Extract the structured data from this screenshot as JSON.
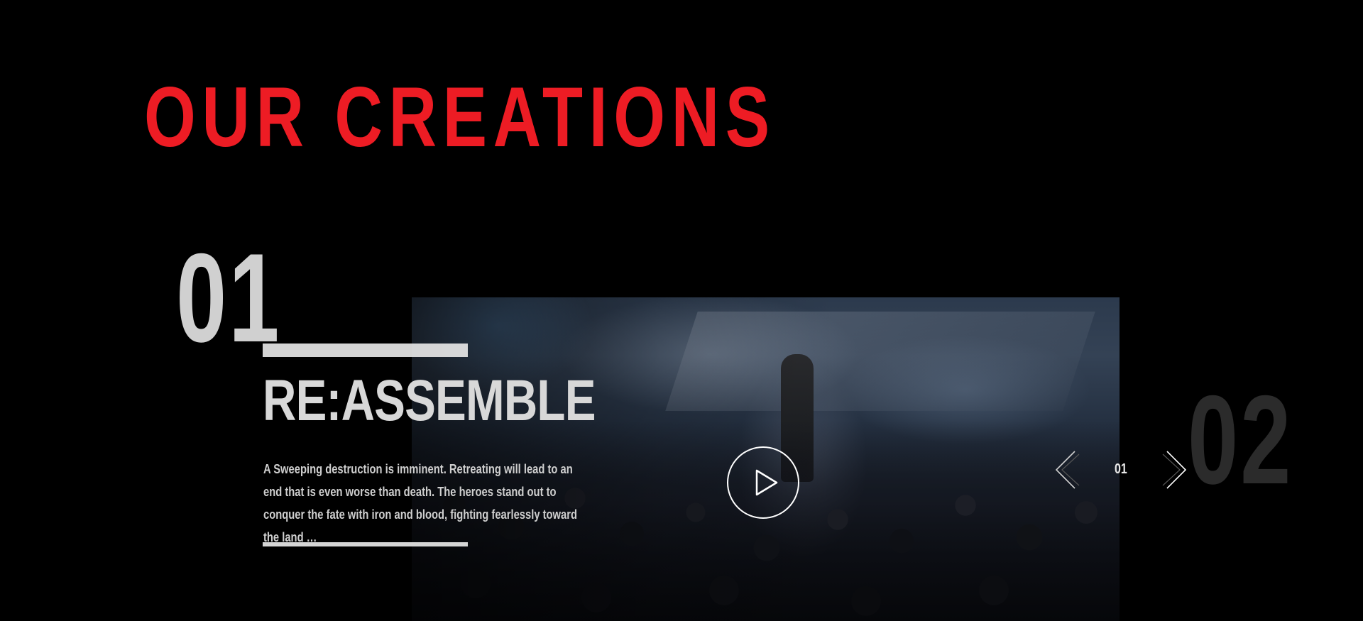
{
  "section": {
    "title": "OUR CREATIONS"
  },
  "slide": {
    "index": "01",
    "next_index": "02",
    "title": "RE:ASSEMBLE",
    "description": "A Sweeping destruction is imminent. Retreating will lead to an end that is even worse than death. The heroes stand out to conquer the fate with iron and blood, fighting fearlessly toward the land …"
  },
  "slider": {
    "counter": "01"
  },
  "icons": {
    "play": "play-icon",
    "prev": "chevron-left-icon",
    "next": "chevron-right-icon"
  },
  "colors": {
    "accent": "#ed1c24",
    "background": "#000000",
    "text": "#d8d8d8",
    "next_index": "#2b2b2b"
  }
}
